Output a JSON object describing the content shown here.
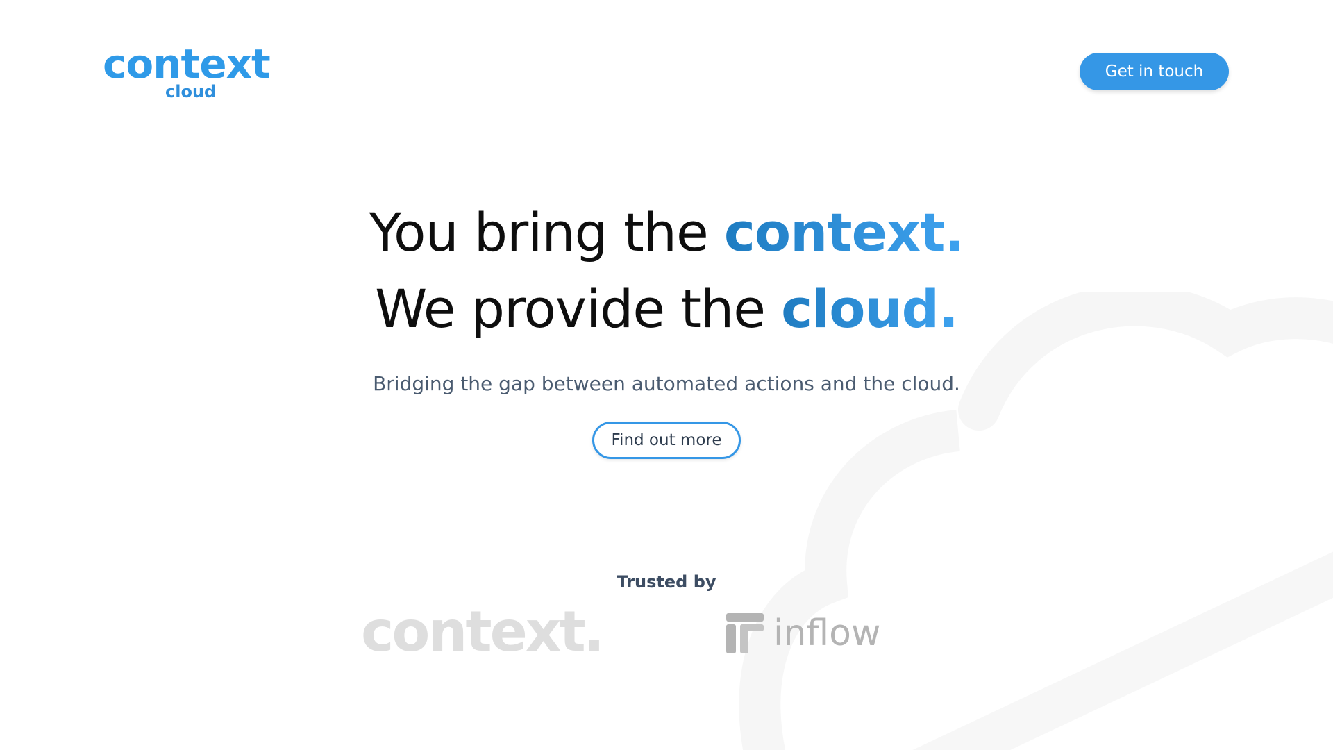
{
  "header": {
    "logo_main": "context",
    "logo_sub": "cloud",
    "cta_label": "Get in touch"
  },
  "hero": {
    "line1_prefix": "You bring the ",
    "line1_highlight": "context.",
    "line2_prefix": "We provide the ",
    "line2_highlight": "cloud.",
    "subtext": "Bridging the gap between automated actions and the cloud.",
    "button_label": "Find out more"
  },
  "trusted": {
    "heading": "Trusted by",
    "brands": [
      "context.",
      "inflow"
    ]
  },
  "colors": {
    "accent": "#3597e6",
    "heading_text": "#0e0e0e",
    "subtext": "#4a5b70",
    "brand_muted": "#dedede"
  },
  "icons": [
    "inflow-logo-icon",
    "cloud-outline-background"
  ]
}
